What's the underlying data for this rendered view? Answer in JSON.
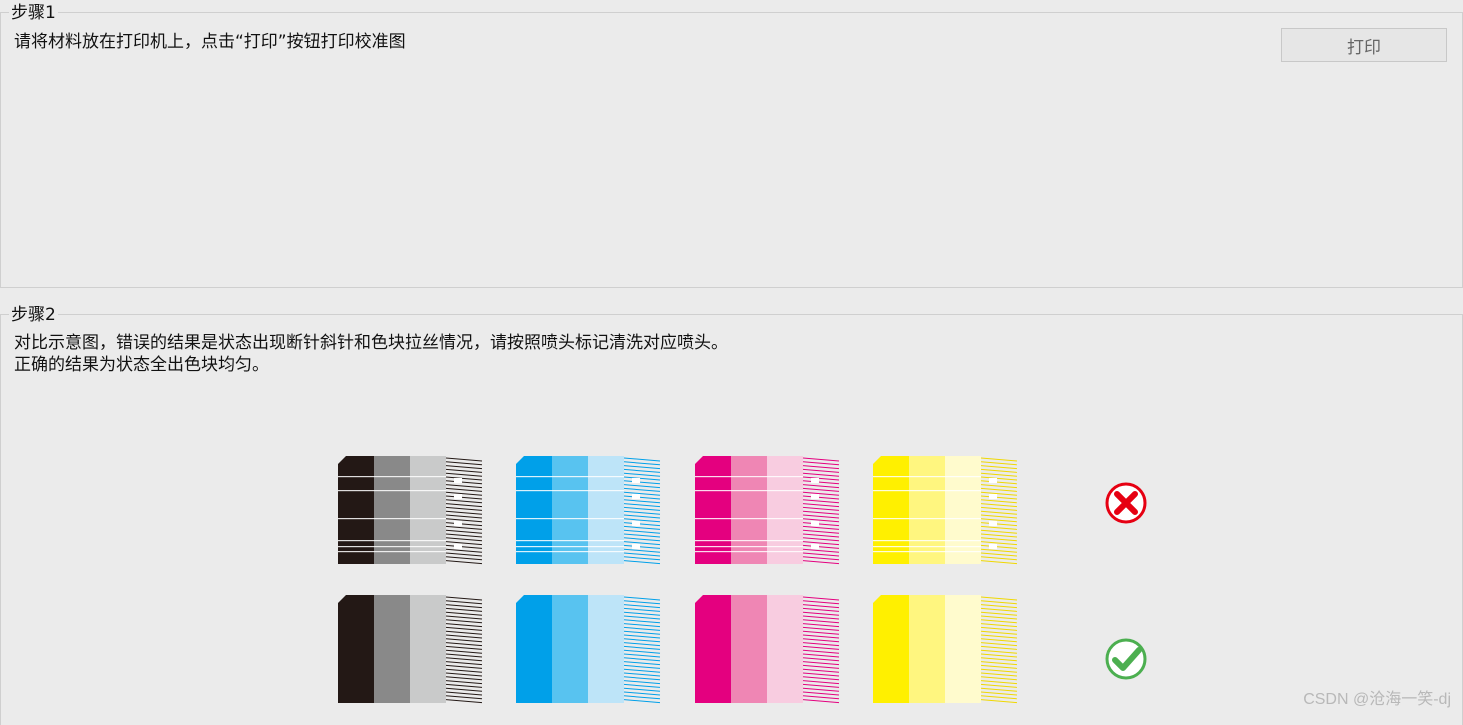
{
  "step1": {
    "title": "步骤1",
    "instruction": "请将材料放在打印机上，点击“打印”按钮打印校准图",
    "print_button": "打印"
  },
  "step2": {
    "title": "步骤2",
    "description_line1": "对比示意图，错误的结果是状态出现断针斜针和色块拉丝情况，请按照喷头标记清洗对应喷头。",
    "description_line2": "正确的结果为状态全出色块均匀。"
  },
  "swatches": {
    "colors": [
      {
        "name": "black",
        "shades": [
          "#231815",
          "#898989",
          "#c9caca"
        ],
        "line": "#231815"
      },
      {
        "name": "cyan",
        "shades": [
          "#00a0e9",
          "#58c3f0",
          "#bde4f8"
        ],
        "line": "#00a0e9"
      },
      {
        "name": "magenta",
        "shades": [
          "#e4007f",
          "#ef86b4",
          "#f8cce0"
        ],
        "line": "#e4007f"
      },
      {
        "name": "yellow",
        "shades": [
          "#fff000",
          "#fff67f",
          "#fffbcd"
        ],
        "line": "#f0d800"
      }
    ],
    "rows": [
      {
        "label": "wrong",
        "icon": "cross-icon",
        "accent": "#e60012"
      },
      {
        "label": "correct",
        "icon": "check-icon",
        "accent": "#4caf50"
      }
    ]
  },
  "watermark": "CSDN @沧海一笑-dj"
}
